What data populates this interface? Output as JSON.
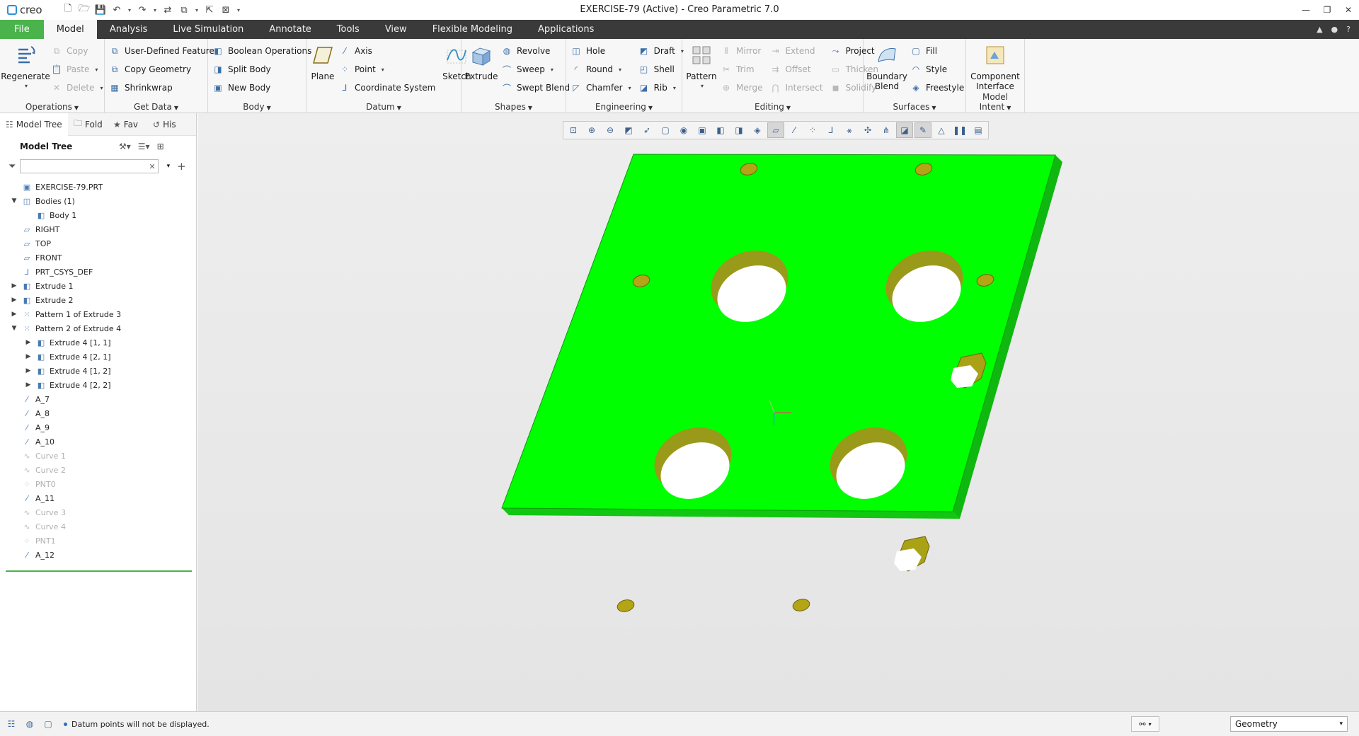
{
  "titlebar": {
    "logo_text": "creo",
    "window_title": "EXERCISE-79 (Active) - Creo Parametric 7.0"
  },
  "tabs": [
    "File",
    "Model",
    "Analysis",
    "Live Simulation",
    "Annotate",
    "Tools",
    "View",
    "Flexible Modeling",
    "Applications"
  ],
  "active_tab": "Model",
  "ribbon": {
    "operations": {
      "regenerate": "Regenerate",
      "copy": "Copy",
      "paste": "Paste",
      "delete": "Delete",
      "label": "Operations"
    },
    "get_data": {
      "udf": "User-Defined Feature",
      "copy_geometry": "Copy Geometry",
      "shrinkwrap": "Shrinkwrap",
      "label": "Get Data"
    },
    "body": {
      "boolean": "Boolean Operations",
      "split": "Split Body",
      "new": "New Body",
      "label": "Body"
    },
    "datum": {
      "plane": "Plane",
      "axis": "Axis",
      "point": "Point",
      "csys": "Coordinate System",
      "sketch": "Sketch",
      "label": "Datum"
    },
    "shapes": {
      "extrude": "Extrude",
      "revolve": "Revolve",
      "sweep": "Sweep",
      "swept_blend": "Swept Blend",
      "label": "Shapes"
    },
    "engineering": {
      "hole": "Hole",
      "round": "Round",
      "chamfer": "Chamfer",
      "draft": "Draft",
      "shell": "Shell",
      "rib": "Rib",
      "label": "Engineering"
    },
    "editing": {
      "pattern": "Pattern",
      "mirror": "Mirror",
      "trim": "Trim",
      "merge": "Merge",
      "extend": "Extend",
      "offset": "Offset",
      "intersect": "Intersect",
      "project": "Project",
      "thicken": "Thicken",
      "solidify": "Solidify",
      "label": "Editing"
    },
    "surfaces": {
      "boundary_blend_1": "Boundary",
      "boundary_blend_2": "Blend",
      "fill": "Fill",
      "style": "Style",
      "freestyle": "Freestyle",
      "label": "Surfaces"
    },
    "model_intent": {
      "component_1": "Component",
      "component_2": "Interface",
      "label": "Model Intent"
    }
  },
  "navigator": {
    "tabs": [
      "Model Tree",
      "Fold",
      "Fav",
      "His"
    ],
    "tree_title": "Model Tree",
    "filter_placeholder": ""
  },
  "tree": [
    {
      "label": "EXERCISE-79.PRT",
      "indent": 0,
      "expander": "",
      "icon": "part-icon",
      "glyph": "▣",
      "dim": false
    },
    {
      "label": "Bodies (1)",
      "indent": 0,
      "expander": "▼",
      "icon": "bodies-icon",
      "glyph": "◫",
      "dim": false
    },
    {
      "label": "Body 1",
      "indent": 1,
      "expander": "",
      "icon": "body-icon",
      "glyph": "◧",
      "dim": false
    },
    {
      "label": "RIGHT",
      "indent": 0,
      "expander": "",
      "icon": "datum-plane-icon",
      "glyph": "▱",
      "dim": false
    },
    {
      "label": "TOP",
      "indent": 0,
      "expander": "",
      "icon": "datum-plane-icon",
      "glyph": "▱",
      "dim": false
    },
    {
      "label": "FRONT",
      "indent": 0,
      "expander": "",
      "icon": "datum-plane-icon",
      "glyph": "▱",
      "dim": false
    },
    {
      "label": "PRT_CSYS_DEF",
      "indent": 0,
      "expander": "",
      "icon": "csys-icon",
      "glyph": "⅃",
      "dim": false
    },
    {
      "label": "Extrude 1",
      "indent": 0,
      "expander": "▶",
      "icon": "extrude-icon",
      "glyph": "◧",
      "dim": false
    },
    {
      "label": "Extrude 2",
      "indent": 0,
      "expander": "▶",
      "icon": "extrude-icon",
      "glyph": "◧",
      "dim": false
    },
    {
      "label": "Pattern 1 of Extrude 3",
      "indent": 0,
      "expander": "▶",
      "icon": "pattern-icon",
      "glyph": "⁙",
      "dim": false
    },
    {
      "label": "Pattern 2 of Extrude 4",
      "indent": 0,
      "expander": "▼",
      "icon": "pattern-icon",
      "glyph": "⁙",
      "dim": false
    },
    {
      "label": "Extrude 4 [1, 1]",
      "indent": 1,
      "expander": "▶",
      "icon": "extrude-icon",
      "glyph": "◧",
      "dim": false
    },
    {
      "label": "Extrude 4 [2, 1]",
      "indent": 1,
      "expander": "▶",
      "icon": "extrude-icon",
      "glyph": "◧",
      "dim": false
    },
    {
      "label": "Extrude 4 [1, 2]",
      "indent": 1,
      "expander": "▶",
      "icon": "extrude-icon",
      "glyph": "◧",
      "dim": false
    },
    {
      "label": "Extrude 4 [2, 2]",
      "indent": 1,
      "expander": "▶",
      "icon": "extrude-icon",
      "glyph": "◧",
      "dim": false
    },
    {
      "label": "A_7",
      "indent": 0,
      "expander": "",
      "icon": "datum-axis-icon",
      "glyph": "⁄",
      "dim": false
    },
    {
      "label": "A_8",
      "indent": 0,
      "expander": "",
      "icon": "datum-axis-icon",
      "glyph": "⁄",
      "dim": false
    },
    {
      "label": "A_9",
      "indent": 0,
      "expander": "",
      "icon": "datum-axis-icon",
      "glyph": "⁄",
      "dim": false
    },
    {
      "label": "A_10",
      "indent": 0,
      "expander": "",
      "icon": "datum-axis-icon",
      "glyph": "⁄",
      "dim": false
    },
    {
      "label": "Curve 1",
      "indent": 0,
      "expander": "",
      "icon": "curve-icon",
      "glyph": "∿",
      "dim": true
    },
    {
      "label": "Curve 2",
      "indent": 0,
      "expander": "",
      "icon": "curve-icon",
      "glyph": "∿",
      "dim": true
    },
    {
      "label": "PNT0",
      "indent": 0,
      "expander": "",
      "icon": "datum-point-icon",
      "glyph": "⁘",
      "dim": true
    },
    {
      "label": "A_11",
      "indent": 0,
      "expander": "",
      "icon": "datum-axis-icon",
      "glyph": "⁄",
      "dim": false
    },
    {
      "label": "Curve 3",
      "indent": 0,
      "expander": "",
      "icon": "curve-icon",
      "glyph": "∿",
      "dim": true
    },
    {
      "label": "Curve 4",
      "indent": 0,
      "expander": "",
      "icon": "curve-icon",
      "glyph": "∿",
      "dim": true
    },
    {
      "label": "PNT1",
      "indent": 0,
      "expander": "",
      "icon": "datum-point-icon",
      "glyph": "⁘",
      "dim": true
    },
    {
      "label": "A_12",
      "indent": 0,
      "expander": "",
      "icon": "datum-axis-icon",
      "glyph": "⁄",
      "dim": false
    }
  ],
  "view_toolbar": [
    {
      "name": "refit-icon",
      "glyph": "⊡",
      "on": false
    },
    {
      "name": "zoom-in-icon",
      "glyph": "⊕",
      "on": false
    },
    {
      "name": "zoom-out-icon",
      "glyph": "⊖",
      "on": false
    },
    {
      "name": "repaint-icon",
      "glyph": "◩",
      "on": false
    },
    {
      "name": "perspective-icon",
      "glyph": "➶",
      "on": false
    },
    {
      "name": "display-style-icon",
      "glyph": "▢",
      "on": false
    },
    {
      "name": "saved-orientations-icon",
      "glyph": "◉",
      "on": false
    },
    {
      "name": "view-manager-icon",
      "glyph": "▣",
      "on": false
    },
    {
      "name": "section-icon",
      "glyph": "◧",
      "on": false
    },
    {
      "name": "hidden-line-icon",
      "glyph": "◨",
      "on": false
    },
    {
      "name": "appearance-icon",
      "glyph": "◈",
      "on": false
    },
    {
      "name": "plane-display-icon",
      "glyph": "▱",
      "on": true
    },
    {
      "name": "axis-display-icon",
      "glyph": "⁄",
      "on": false
    },
    {
      "name": "point-display-icon",
      "glyph": "⁘",
      "on": false
    },
    {
      "name": "csys-display-icon",
      "glyph": "⅃",
      "on": false
    },
    {
      "name": "annotation-display-icon",
      "glyph": "⚹",
      "on": false
    },
    {
      "name": "spin-center-icon",
      "glyph": "✣",
      "on": false
    },
    {
      "name": "datum-tag-icon",
      "glyph": "⋔",
      "on": false
    },
    {
      "name": "model-display-icon",
      "glyph": "◪",
      "on": true
    },
    {
      "name": "sketch-display-icon",
      "glyph": "✎",
      "on": true
    },
    {
      "name": "simulation-display-icon",
      "glyph": "△",
      "on": false
    },
    {
      "name": "pause-icon",
      "glyph": "❚❚",
      "on": false
    },
    {
      "name": "annotations-icon",
      "glyph": "▤",
      "on": false
    }
  ],
  "status": {
    "message": "Datum points will not be displayed.",
    "selection_filter": "Geometry"
  },
  "colors": {
    "model_face": "#00ff00",
    "model_side": "#0ec40e",
    "hole_wall": "#9a9a1a",
    "file_tab": "#4bb34b",
    "tabbar": "#3a3a3a"
  }
}
